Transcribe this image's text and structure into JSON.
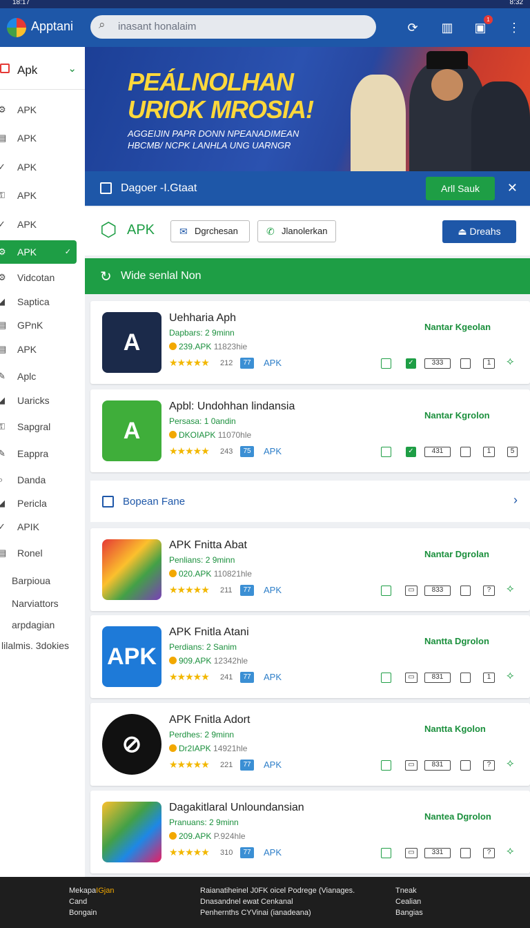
{
  "status": {
    "time": "18:17",
    "right": "8:32"
  },
  "app": {
    "name": "Apptani"
  },
  "search": {
    "placeholder": "inasant honalaim"
  },
  "sidebar": {
    "header": "Apk",
    "items": [
      {
        "label": "APK",
        "icon": "gear-icon"
      },
      {
        "label": "APK",
        "icon": "grid-icon"
      },
      {
        "label": "APK",
        "icon": "check-icon"
      },
      {
        "label": "APK",
        "icon": "lock-icon"
      },
      {
        "label": "APK",
        "icon": "check-icon"
      },
      {
        "label": "APK",
        "icon": "gear-icon",
        "active": true
      },
      {
        "label": "Vidcotan",
        "icon": "gear-icon"
      },
      {
        "label": "Saptica",
        "icon": "chart-icon"
      },
      {
        "label": "GPnK",
        "icon": "grid-icon"
      },
      {
        "label": "APK",
        "icon": "grid-icon"
      },
      {
        "label": "Aplc",
        "icon": "brush-icon"
      },
      {
        "label": "Uaricks",
        "icon": "chart-icon"
      },
      {
        "label": "Sapgral",
        "icon": "lock-icon"
      },
      {
        "label": "Eappra",
        "icon": "brush-icon"
      },
      {
        "label": "Danda",
        "icon": "search-icon"
      },
      {
        "label": "Pericla",
        "icon": "chart-icon"
      },
      {
        "label": "APIK",
        "icon": "check-icon"
      },
      {
        "label": "Ronel",
        "icon": "grid-icon"
      }
    ],
    "footer_items": [
      "Barpioua",
      "Narviattors",
      "arpdagian",
      "lilalmis. 3dokies"
    ]
  },
  "banner": {
    "title1": "PEÁLNOLHAN",
    "title2": "URIOK MROSIA!",
    "sub1": "AGGEIJIN PAPR DONN NPEANADIMEAN",
    "sub2": "HBCMB/ NCPK LANHLA UNG UARNGR"
  },
  "subheader": {
    "title": "Dagoer -I.Gtaat",
    "action": "Arll Sauk"
  },
  "toolbar": {
    "brand": "APK",
    "btn1": "Dgrchesan",
    "btn2": "Jlanolerkan",
    "primary": "Dreahs"
  },
  "section": {
    "title": "Wide senlal Non"
  },
  "cards": [
    {
      "name": "Uehharia Aph",
      "developer": "Dapbars: 2 9minn",
      "size": "239.APK",
      "size2": "11823hie",
      "rating_count": "212",
      "tag": "77",
      "type": "APK",
      "install": "Nantar Kgeolan",
      "counter": "333",
      "page": "1"
    },
    {
      "name": "Apbl: Undohhan lindansia",
      "developer": "Persasa: 1 0andin",
      "size": "DKOIAPK",
      "size2": "11070hle",
      "rating_count": "243",
      "tag": "75",
      "type": "APK",
      "install": "Nantar Kgrolon",
      "counter": "431",
      "page": "1",
      "extra": "5"
    },
    {
      "name": "APK Fnitta Abat",
      "developer": "Penlians: 2 9minn",
      "size": "020.APK",
      "size2": "110821hle",
      "rating_count": "211",
      "tag": "77",
      "type": "APK",
      "install": "Nantar Dgrolan",
      "counter": "833",
      "page": "?"
    },
    {
      "name": "APK Fnitla Atani",
      "developer": "Perdians: 2 Sanim",
      "size": "909.APK",
      "size2": "12342hle",
      "rating_count": "241",
      "tag": "77",
      "type": "APK",
      "install": "Nantta Dgrolon",
      "counter": "831",
      "page": "1"
    },
    {
      "name": "APK Fnitla Adort",
      "developer": "Perdhes: 2 9minn",
      "size": "Dr2IAPK",
      "size2": "14921hle",
      "rating_count": "221",
      "tag": "77",
      "type": "APK",
      "install": "Nantta Kgolon",
      "counter": "831",
      "page": "?"
    },
    {
      "name": "Dagakitlaral Unloundansian",
      "developer": "Pranuans: 2 9minn",
      "size": "209.APK",
      "size2": "P.924hle",
      "rating_count": "310",
      "tag": "77",
      "type": "APK",
      "install": "Nantea Dgrolon",
      "counter": "331",
      "page": "?"
    }
  ],
  "open_row": {
    "label": "Bopean Fane"
  },
  "footer": {
    "col1": [
      "Mekapa",
      "Cand",
      "Bongain"
    ],
    "col1_highlight": "IGjan",
    "col2": [
      "Raianatiheinel J0FK oicel Podrege (Vianages.",
      "Dnasandnel ewat Cenkanal",
      "Penhernths CYVinai (ianadeana)"
    ],
    "col3": [
      "Tneak",
      "Cealian",
      "Bangias"
    ]
  },
  "colors": {
    "blue": "#1e57a8",
    "green": "#1e9e45",
    "yellow": "#ffd83b"
  }
}
